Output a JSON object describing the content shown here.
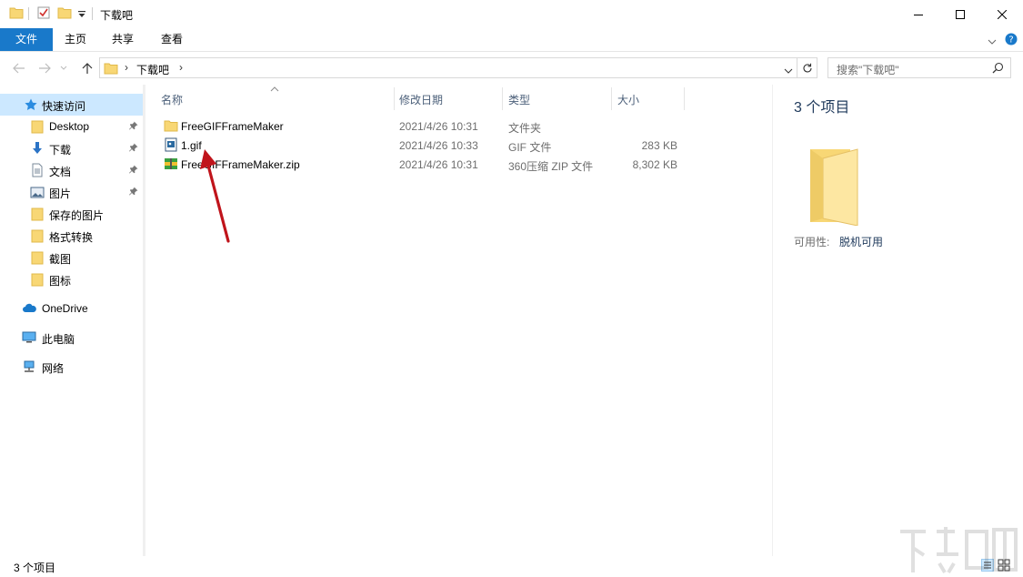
{
  "window": {
    "title": "下载吧"
  },
  "ribbon": {
    "tabs": [
      "文件",
      "主页",
      "共享",
      "查看"
    ]
  },
  "address": {
    "crumb": "下载吧"
  },
  "search": {
    "placeholder": "搜索\"下载吧\""
  },
  "nav": {
    "quick_access": "快速访问",
    "items": [
      {
        "label": "Desktop",
        "icon": "folder-icon",
        "pinned": true
      },
      {
        "label": "下载",
        "icon": "download-icon",
        "pinned": true
      },
      {
        "label": "文档",
        "icon": "document-icon",
        "pinned": true
      },
      {
        "label": "图片",
        "icon": "pictures-icon",
        "pinned": true
      },
      {
        "label": "保存的图片",
        "icon": "folder-icon",
        "pinned": false
      },
      {
        "label": "格式转换",
        "icon": "folder-icon",
        "pinned": false
      },
      {
        "label": "截图",
        "icon": "folder-icon",
        "pinned": false
      },
      {
        "label": "图标",
        "icon": "folder-icon",
        "pinned": false
      }
    ],
    "onedrive": "OneDrive",
    "this_pc": "此电脑",
    "network": "网络"
  },
  "columns": {
    "name": "名称",
    "date": "修改日期",
    "type": "类型",
    "size": "大小"
  },
  "files": [
    {
      "name": "FreeGIFFrameMaker",
      "date": "2021/4/26 10:31",
      "type": "文件夹",
      "size": "",
      "icon": "folder-icon"
    },
    {
      "name": "1.gif",
      "date": "2021/4/26 10:33",
      "type": "GIF 文件",
      "size": "283 KB",
      "icon": "gif-file-icon"
    },
    {
      "name": "FreeGIFFrameMaker.zip",
      "date": "2021/4/26 10:31",
      "type": "360压缩 ZIP 文件",
      "size": "8,302 KB",
      "icon": "zip-archive-icon"
    }
  ],
  "details": {
    "count": "3 个项目",
    "availability_label": "可用性:",
    "availability_value": "脱机可用"
  },
  "status": {
    "count": "3 个项目"
  },
  "colors": {
    "accent": "#1979ca",
    "selected": "#cce8ff",
    "folder": "#f8d775",
    "arrow": "#c0141b"
  }
}
